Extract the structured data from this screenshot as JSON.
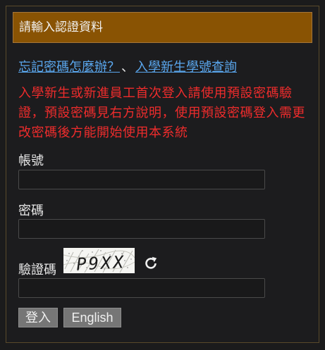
{
  "header": {
    "title": "請輸入認證資料"
  },
  "links": {
    "forgot_password": "忘記密碼怎麼辦？",
    "separator": "、",
    "new_student_id_lookup": "入學新生學號查詢"
  },
  "notice": "入學新生或新進員工首次登入請使用預設密碼驗證，預設密碼見右方說明，使用預設密碼登入需更改密碼後方能開始使用本系統",
  "form": {
    "account_label": "帳號",
    "account_value": "",
    "password_label": "密碼",
    "password_value": "",
    "captcha_label": "驗證碼",
    "captcha_image_text": "P9XX",
    "captcha_value": ""
  },
  "buttons": {
    "login": "登入",
    "english": "English"
  },
  "icons": {
    "refresh": "refresh-icon"
  },
  "colors": {
    "header_bg": "#895303",
    "link": "#5aa7ee",
    "notice": "#ef2c2c",
    "button_bg": "#767676"
  }
}
